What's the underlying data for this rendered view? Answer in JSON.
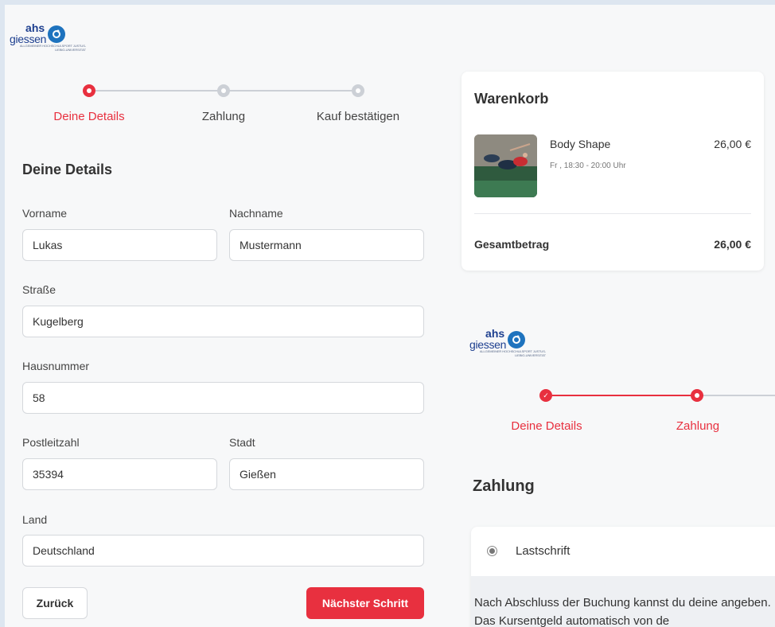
{
  "logo": {
    "primary": "ahs",
    "secondary": "giessen",
    "tagline": "ALLGEMEINER HOCHSCHULSPORT JUSTUS-LIEBIG-UNIVERSITÄT"
  },
  "stepper": {
    "steps": [
      {
        "label": "Deine Details",
        "state": "active"
      },
      {
        "label": "Zahlung",
        "state": "inactive"
      },
      {
        "label": "Kauf bestätigen",
        "state": "inactive"
      }
    ]
  },
  "details": {
    "title": "Deine Details",
    "firstname": {
      "label": "Vorname",
      "value": "Lukas"
    },
    "lastname": {
      "label": "Nachname",
      "value": "Mustermann"
    },
    "street": {
      "label": "Straße",
      "value": "Kugelberg"
    },
    "housenumber": {
      "label": "Hausnummer",
      "value": "58"
    },
    "zip": {
      "label": "Postleitzahl",
      "value": "35394"
    },
    "city": {
      "label": "Stadt",
      "value": "Gießen"
    },
    "country": {
      "label": "Land",
      "value": "Deutschland"
    },
    "back_label": "Zurück",
    "next_label": "Nächster Schritt"
  },
  "cart": {
    "title": "Warenkorb",
    "item": {
      "name": "Body Shape",
      "time": "Fr , 18:30  - 20:00 Uhr",
      "price": "26,00 €"
    },
    "total_label": "Gesamtbetrag",
    "total_value": "26,00 €"
  },
  "payment_preview": {
    "stepper": [
      {
        "label": "Deine Details",
        "state": "done"
      },
      {
        "label": "Zahlung",
        "state": "active"
      }
    ],
    "check_glyph": "✓",
    "title": "Zahlung",
    "method_label": "Lastschrift",
    "description": "Nach Abschluss der Buchung kannst du deine angeben. Das Kursentgeld automatisch von de"
  },
  "colors": {
    "accent": "#e8303f",
    "inactive": "#ccd0d6",
    "brand": "#1d3f8f"
  },
  "icons": {
    "check": "check-icon",
    "radio": "radio-icon",
    "logo": "ahs-logo-icon"
  }
}
